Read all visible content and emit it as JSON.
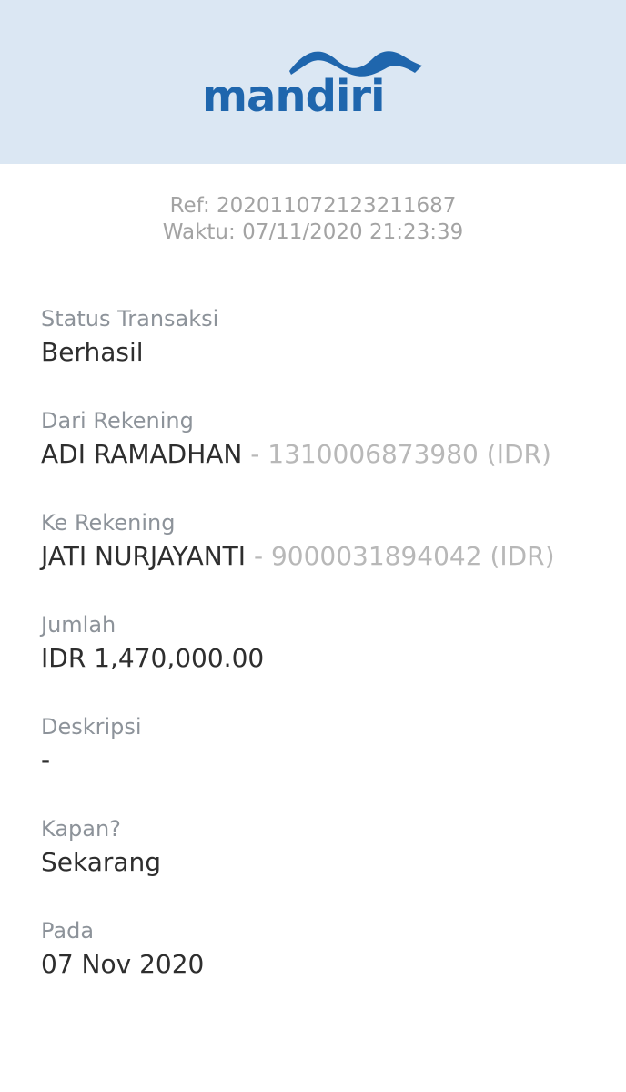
{
  "header": {
    "brand": "mandiri",
    "brand_color": "#1f66ad",
    "background_color": "#dbe7f3"
  },
  "meta": {
    "ref": "Ref: 202011072123211687",
    "waktu": "Waktu: 07/11/2020 21:23:39"
  },
  "fields": {
    "status": {
      "label": "Status Transaksi",
      "value": "Berhasil"
    },
    "from": {
      "label": "Dari Rekening",
      "name": "ADI RAMADHAN",
      "account": " - 1310006873980 (IDR)"
    },
    "to": {
      "label": "Ke Rekening",
      "name": "JATI NURJAYANTI",
      "account": " - 9000031894042 (IDR)"
    },
    "amount": {
      "label": "Jumlah",
      "value": "IDR 1,470,000.00"
    },
    "description": {
      "label": "Deskripsi",
      "value": "-"
    },
    "when": {
      "label": "Kapan?",
      "value": "Sekarang"
    },
    "date": {
      "label": "Pada",
      "value": "07 Nov 2020"
    }
  }
}
